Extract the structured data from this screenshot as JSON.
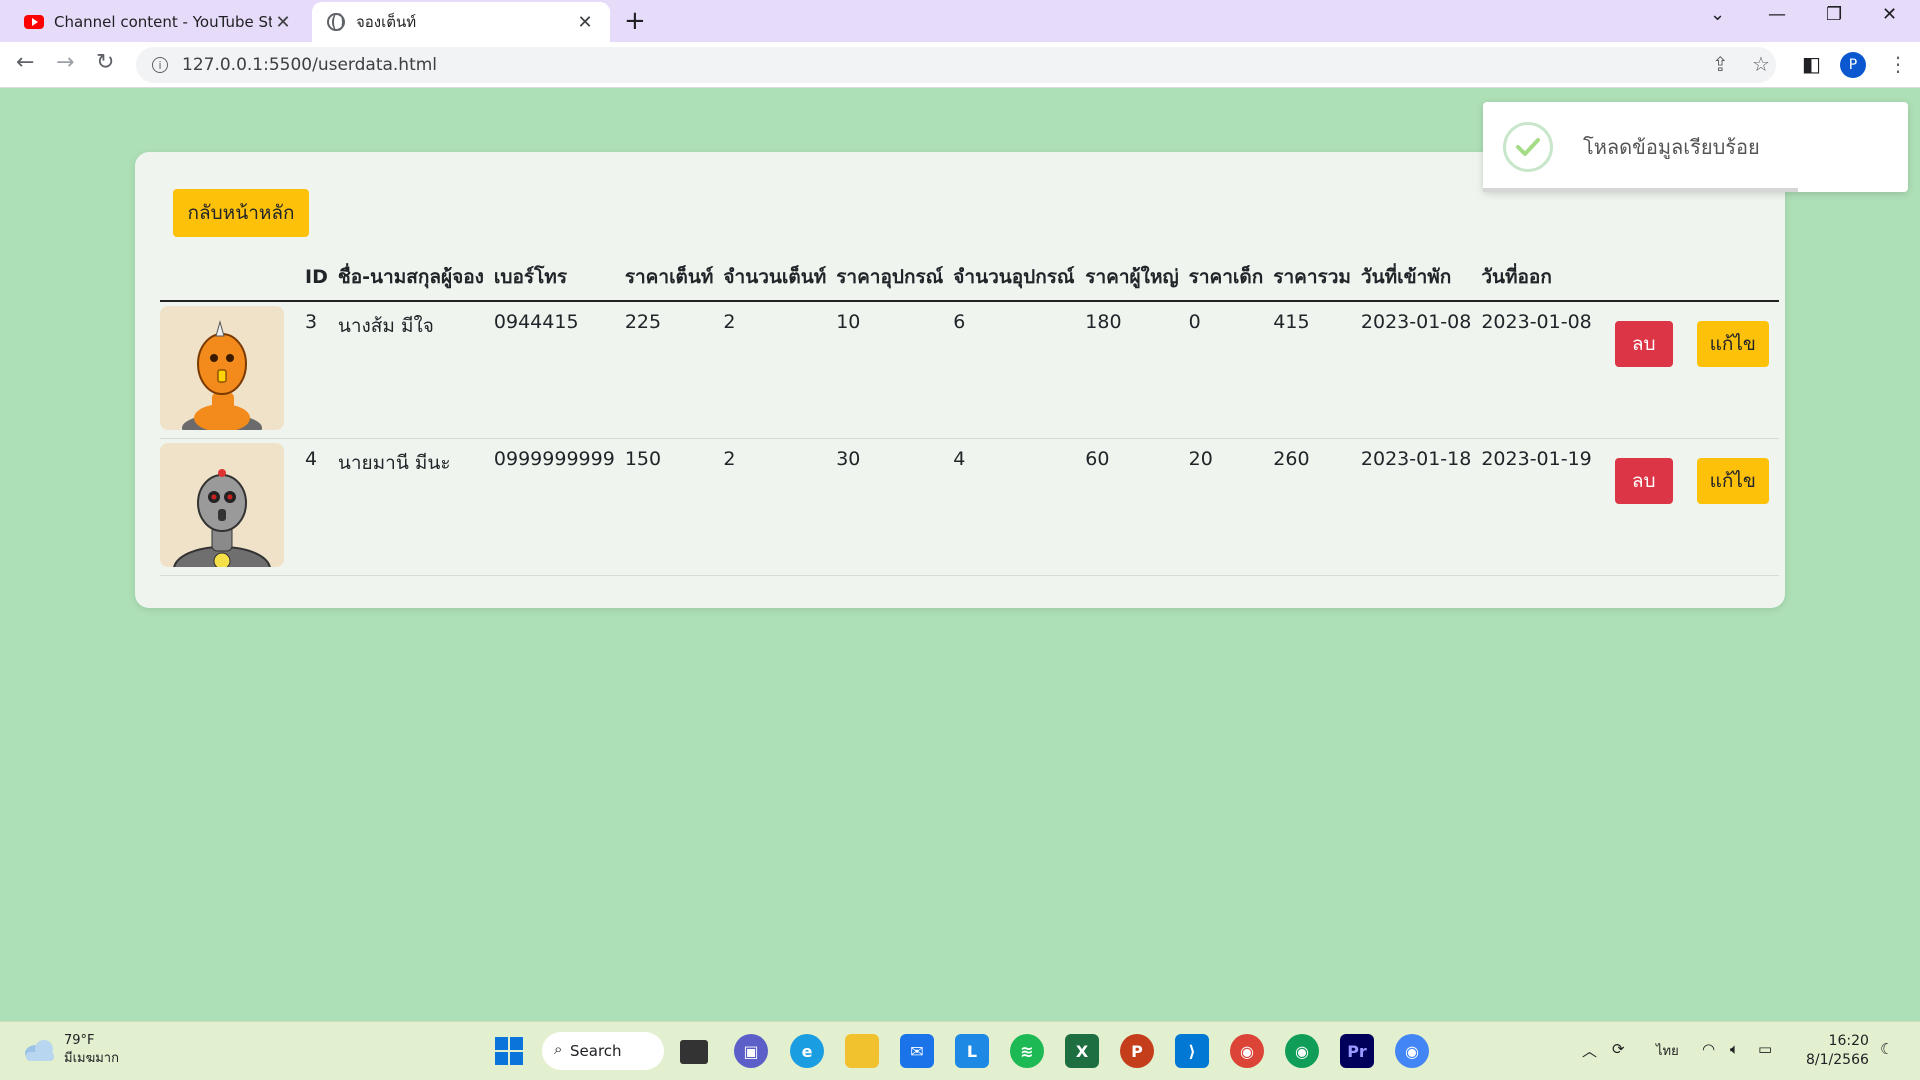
{
  "browser": {
    "tabs": [
      {
        "title": "Channel content - YouTube Studio",
        "icon": "youtube-icon"
      },
      {
        "title": "จองเต็นท์",
        "icon": "globe-icon"
      }
    ],
    "url": "127.0.0.1:5500/userdata.html",
    "profile_initial": "P"
  },
  "page": {
    "home_button": "กลับหน้าหลัก",
    "columns": [
      "ID",
      "ชื่อ-นามสกุลผู้จอง",
      "เบอร์โทร",
      "ราคาเต็นท์",
      "จำนวนเต็นท์",
      "ราคาอุปกรณ์",
      "จำนวนอุปกรณ์",
      "ราคาผู้ใหญ่",
      "ราคาเด็ก",
      "ราคารวม",
      "วันที่เข้าพัก",
      "วันที่ออก"
    ],
    "rows": [
      {
        "id": "3",
        "name": "นางส้ม มีใจ",
        "phone": "0944415",
        "tent_price": "225",
        "tent_count": "2",
        "equip_price": "10",
        "equip_count": "6",
        "adult_price": "180",
        "child_price": "0",
        "total": "415",
        "checkin": "2023-01-08",
        "checkout": "2023-01-08",
        "delete_label": "ลบ",
        "edit_label": "แก้ไข"
      },
      {
        "id": "4",
        "name": "นายมานี มีนะ",
        "phone": "0999999999",
        "tent_price": "150",
        "tent_count": "2",
        "equip_price": "30",
        "equip_count": "4",
        "adult_price": "60",
        "child_price": "20",
        "total": "260",
        "checkin": "2023-01-18",
        "checkout": "2023-01-19",
        "delete_label": "ลบ",
        "edit_label": "แก้ไข"
      }
    ]
  },
  "toast": {
    "message": "โหลดข้อมูลเรียบร้อย",
    "progress": 0.74
  },
  "taskbar": {
    "weather_temp": "79°F",
    "weather_desc": "มีเมฆมาก",
    "search_label": "Search",
    "language": "ไทย",
    "time": "16:20",
    "date": "8/1/2566"
  },
  "colors": {
    "page_bg": "#aee0b7",
    "warning": "#fdc10a",
    "danger": "#dc3545"
  }
}
